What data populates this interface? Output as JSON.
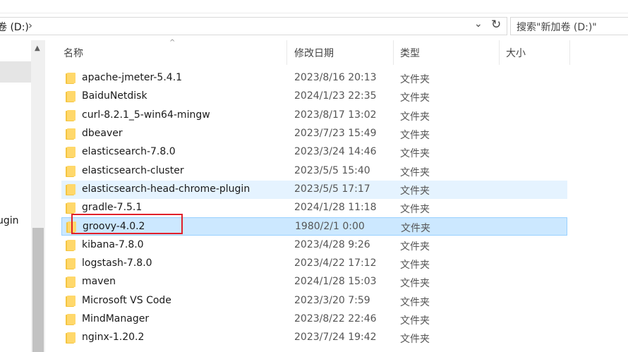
{
  "address": {
    "path": "卷 (D:)",
    "separator": "›",
    "dropdown": "⌄",
    "refresh": "↻"
  },
  "search": {
    "placeholder": "搜索\"新加卷 (D:)\""
  },
  "nav": {
    "items": [
      {
        "label": "ugin"
      }
    ]
  },
  "columns": {
    "name": "名称",
    "date": "修改日期",
    "type": "类型",
    "size": "大小",
    "sort_indicator": "^"
  },
  "colors": {
    "folder": "#f4c542",
    "hover": "#e5f3ff",
    "selected": "#cce8ff",
    "annotation": "#e0202a"
  },
  "rows": [
    {
      "name": "apache-jmeter-5.4.1",
      "date": "2023/8/16 20:13",
      "type": "文件夹"
    },
    {
      "name": "BaiduNetdisk",
      "date": "2024/1/23 22:35",
      "type": "文件夹"
    },
    {
      "name": "curl-8.2.1_5-win64-mingw",
      "date": "2023/8/17 13:02",
      "type": "文件夹"
    },
    {
      "name": "dbeaver",
      "date": "2023/7/23 15:49",
      "type": "文件夹"
    },
    {
      "name": "elasticsearch-7.8.0",
      "date": "2023/3/24 14:46",
      "type": "文件夹"
    },
    {
      "name": "elasticsearch-cluster",
      "date": "2023/5/5 15:40",
      "type": "文件夹"
    },
    {
      "name": "elasticsearch-head-chrome-plugin",
      "date": "2023/5/5 17:17",
      "type": "文件夹"
    },
    {
      "name": "gradle-7.5.1",
      "date": "2024/1/28 11:18",
      "type": "文件夹"
    },
    {
      "name": "groovy-4.0.2",
      "date": "1980/2/1 0:00",
      "type": "文件夹"
    },
    {
      "name": "kibana-7.8.0",
      "date": "2023/4/28 9:26",
      "type": "文件夹"
    },
    {
      "name": "logstash-7.8.0",
      "date": "2023/4/22 17:12",
      "type": "文件夹"
    },
    {
      "name": "maven",
      "date": "2024/1/28 15:03",
      "type": "文件夹"
    },
    {
      "name": "Microsoft VS Code",
      "date": "2023/3/20 7:59",
      "type": "文件夹"
    },
    {
      "name": "MindManager",
      "date": "2023/8/22 22:46",
      "type": "文件夹"
    },
    {
      "name": "nginx-1.20.2",
      "date": "2023/7/24 19:42",
      "type": "文件夹"
    }
  ]
}
